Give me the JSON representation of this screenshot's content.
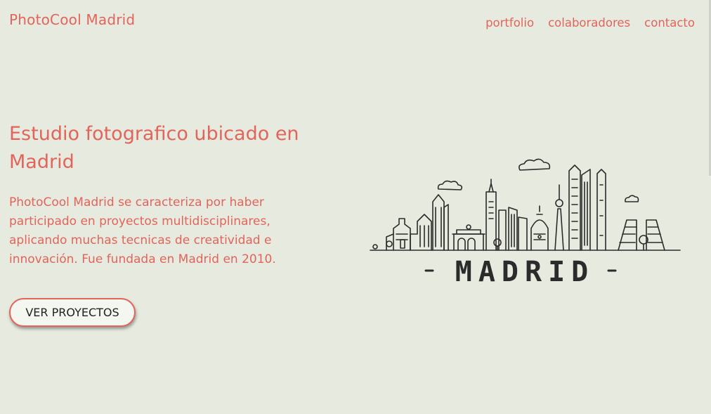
{
  "header": {
    "brand": "PhotoCool Madrid",
    "nav": {
      "portfolio": "portfolio",
      "colaboradores": "colaboradores",
      "contacto": "contacto"
    }
  },
  "hero": {
    "title": "Estudio fotografico ubicado en Madrid",
    "description": "PhotoCool Madrid se caracteriza por haber participado en proyectos multidisciplinares, aplicando muchas tecnicas de creatividad e innovación. Fue fundada en Madrid en 2010.",
    "button_label": "VER PROYECTOS"
  },
  "illustration": {
    "caption": "-MADRID-"
  },
  "colors": {
    "accent": "#e2645a",
    "background": "#e6eadf",
    "ink": "#2b2b2b"
  }
}
